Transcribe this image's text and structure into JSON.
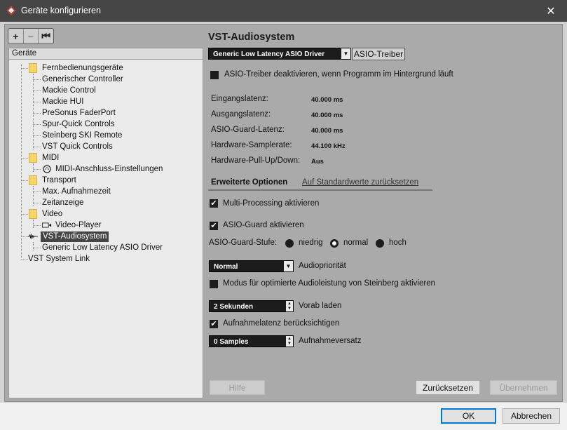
{
  "window": {
    "title": "Geräte konfigurieren"
  },
  "toolbar": {
    "add": "+",
    "remove": "−",
    "reset": "⏮"
  },
  "tree": {
    "header": "Geräte",
    "items": [
      {
        "label": "Fernbedienungsgeräte",
        "icon": "folder-icon"
      },
      {
        "label": "Generischer Controller"
      },
      {
        "label": "Mackie Control"
      },
      {
        "label": "Mackie HUI"
      },
      {
        "label": "PreSonus FaderPort"
      },
      {
        "label": "Spur-Quick Controls"
      },
      {
        "label": "Steinberg SKI Remote"
      },
      {
        "label": "VST Quick Controls"
      },
      {
        "label": "MIDI",
        "icon": "folder-icon"
      },
      {
        "label": "MIDI-Anschluss-Einstellungen",
        "icon": "midi-port-icon"
      },
      {
        "label": "Transport",
        "icon": "folder-icon"
      },
      {
        "label": "Max. Aufnahmezeit"
      },
      {
        "label": "Zeitanzeige"
      },
      {
        "label": "Video",
        "icon": "folder-icon"
      },
      {
        "label": "Video-Player",
        "icon": "video-icon"
      },
      {
        "label": "VST-Audiosystem",
        "icon": "audio-wave-icon",
        "selected": true
      },
      {
        "label": "Generic Low Latency ASIO Driver"
      },
      {
        "label": "VST System Link"
      }
    ]
  },
  "panel": {
    "heading": "VST-Audiosystem",
    "driver": {
      "value": "Generic Low Latency ASIO Driver",
      "button": "ASIO-Treiber"
    },
    "deactivate_label": "ASIO-Treiber deaktivieren, wenn Programm im Hintergrund läuft",
    "info": [
      {
        "label": "Eingangslatenz:",
        "value": "40.000 ms"
      },
      {
        "label": "Ausgangslatenz:",
        "value": "40.000 ms"
      },
      {
        "label": "ASIO-Guard-Latenz:",
        "value": "40.000 ms"
      },
      {
        "label": "Hardware-Samplerate:",
        "value": "44.100 kHz"
      },
      {
        "label": "Hardware-Pull-Up/Down:",
        "value": "Aus"
      }
    ],
    "tabs": {
      "advanced": "Erweiterte Optionen",
      "defaults": "Auf Standardwerte zurücksetzen"
    },
    "multiprocessing": "Multi-Processing aktivieren",
    "asio_guard": "ASIO-Guard aktivieren",
    "guard_level": {
      "label": "ASIO-Guard-Stufe:",
      "low": "niedrig",
      "normal": "normal",
      "high": "hoch",
      "selected": "normal"
    },
    "priority": {
      "value": "Normal",
      "label": "Audiopriorität"
    },
    "steinberg_mode": "Modus für optimierte Audioleistung von Steinberg aktivieren",
    "preload": {
      "value": "2 Sekunden",
      "label": "Vorab laden"
    },
    "record_latency": "Aufnahmelatenz berücksichtigen",
    "record_offset": {
      "value": "0 Samples",
      "label": "Aufnahmeversatz"
    },
    "buttons": {
      "help": "Hilfe",
      "reset": "Zurücksetzen",
      "apply": "Übernehmen"
    }
  },
  "footer": {
    "ok": "OK",
    "cancel": "Abbrechen"
  },
  "colors": {
    "titlebar": "#464646",
    "accent": "#0078d7",
    "panel_bg": "#d2d2d2",
    "dark_control": "#1c1c1c",
    "folder": "#f5d66e"
  }
}
